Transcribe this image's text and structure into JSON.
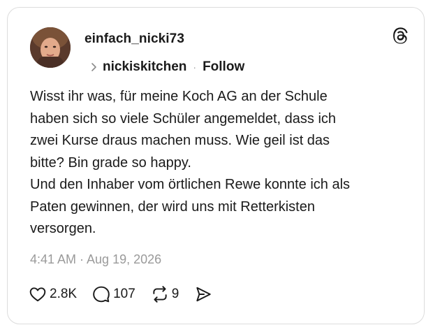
{
  "post": {
    "username": "einfach_nicki73",
    "reply_context": {
      "name": "nickiskitchen",
      "separator": "·",
      "follow_label": "Follow"
    },
    "text": "Wisst ihr was, für meine Koch AG an der Schule\nhaben sich so viele Schüler angemeldet, dass ich\nzwei Kurse draus machen muss. Wie geil ist das\nbitte? Bin grade so happy.\nUnd den Inhaber vom örtlichen Rewe konnte ich als\nPaten gewinnen, der wird uns mit Retterkisten\nversorgen.",
    "timestamp": "4:41 AM · Aug 19, 2026",
    "stats": {
      "likes": "2.8K",
      "replies": "107",
      "reposts": "9"
    }
  },
  "icons": {
    "brand": "threads-logo-icon",
    "like": "heart-icon",
    "reply": "comment-bubble-icon",
    "repost": "repost-icon",
    "share": "send-icon",
    "chevron": "chevron-right-icon"
  },
  "colors": {
    "text": "#1a1a1a",
    "muted": "#9a9a9a",
    "border": "#dcdcdc"
  }
}
